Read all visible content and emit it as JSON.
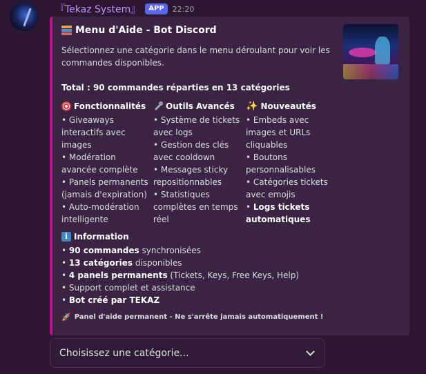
{
  "message": {
    "author": "『Tekaz System』",
    "badge": "APP",
    "time": "22:20"
  },
  "embed": {
    "accent_color": "#b6158d",
    "title": "Menu d'Aide - Bot Discord",
    "title_icon": "books-icon",
    "description": "Sélectionnez une catégorie dans le menu déroulant pour voir les commandes disponibles.",
    "total": "Total : 90 commandes réparties en 13 catégories",
    "columns": [
      {
        "icon": "target-icon",
        "heading": "Fonctionnalités",
        "items": [
          {
            "text": "• Giveaways interactifs avec images"
          },
          {
            "text": "• Modération avancée complète"
          },
          {
            "text": "• Panels permanents (jamais d'expiration)"
          },
          {
            "text": "• Auto-modération intelligente"
          }
        ]
      },
      {
        "icon": "wrench-icon",
        "heading": "Outils Avancés",
        "items": [
          {
            "text": "• Système de tickets avec logs"
          },
          {
            "text": "• Gestion des clés avec cooldown"
          },
          {
            "text": "• Messages sticky repositionnables"
          },
          {
            "text": "• Statistiques complètes en temps réel"
          }
        ]
      },
      {
        "icon": "sparkle-icon",
        "heading": "Nouveautés",
        "items": [
          {
            "text": "• Embeds avec images et URLs cliquables"
          },
          {
            "text": "• Boutons personnalisables"
          },
          {
            "text": "• Catégories tickets avec emojis"
          },
          {
            "prefix": "• ",
            "bold": "Logs tickets automatiques"
          }
        ]
      }
    ],
    "information": {
      "icon": "info-icon",
      "heading": "Information",
      "items": [
        {
          "prefix": "• ",
          "bold": "90 commandes",
          "rest": " synchronisées"
        },
        {
          "prefix": "• ",
          "bold": "13 catégories",
          "rest": " disponibles"
        },
        {
          "prefix": "• ",
          "bold": "4 panels permanents",
          "rest": " (Tickets, Keys, Free Keys, Help)"
        },
        {
          "prefix": "• ",
          "bold": "",
          "rest": "Support complet et assistance"
        },
        {
          "prefix": "• ",
          "bold": "Bot créé par TEKAZ",
          "rest": ""
        }
      ]
    },
    "footer": "Panel d'aide permanent - Ne s'arrête jamais automatiquement !",
    "footer_icon": "rocket-icon"
  },
  "select_menu": {
    "placeholder": "Choisissez une catégorie..."
  }
}
